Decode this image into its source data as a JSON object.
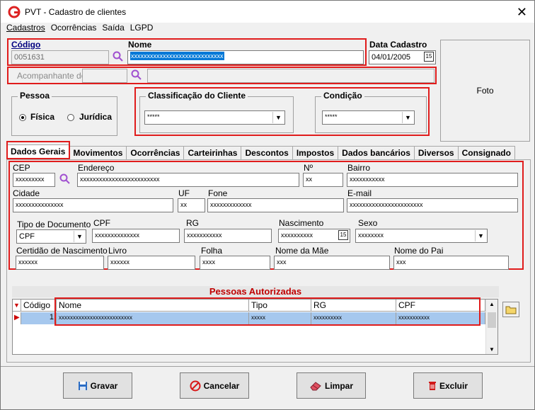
{
  "window": {
    "title": "PVT - Cadastro de clientes",
    "close_label": "✕"
  },
  "menu": [
    "Cadastros",
    "Ocorrências",
    "Saída",
    "LGPD"
  ],
  "header": {
    "codigo_label": "Código",
    "codigo_value": "0051631",
    "nome_label": "Nome",
    "nome_value": "xxxxxxxxxxxxxxxxxxxxxxxxxxxxx",
    "data_cadastro_label": "Data Cadastro",
    "data_cadastro_value": "04/01/2005",
    "acompanhante_label": "Acompanhante de",
    "foto_label": "Foto"
  },
  "pessoa": {
    "label": "Pessoa",
    "fisica": "Física",
    "juridica": "Jurídica",
    "selected": "Física"
  },
  "classificacao": {
    "label": "Classificação do Cliente",
    "value": "*****"
  },
  "condicao": {
    "label": "Condição",
    "value": "*****"
  },
  "tabs": [
    "Dados Gerais",
    "Movimentos",
    "Ocorrências",
    "Carteirinhas",
    "Descontos",
    "Impostos",
    "Dados bancários",
    "Diversos",
    "Consignado"
  ],
  "fields": {
    "cep_label": "CEP",
    "cep_value": "xxxxxxxxx",
    "endereco_label": "Endereço",
    "endereco_value": "xxxxxxxxxxxxxxxxxxxxxxxxx",
    "numero_label": "Nº",
    "numero_value": "xx",
    "bairro_label": "Bairro",
    "bairro_value": "xxxxxxxxxxx",
    "cidade_label": "Cidade",
    "cidade_value": "xxxxxxxxxxxxxxx",
    "uf_label": "UF",
    "uf_value": "xx",
    "fone_label": "Fone",
    "fone_value": "xxxxxxxxxxxxx",
    "email_label": "E-mail",
    "email_value": "xxxxxxxxxxxxxxxxxxxxxxx",
    "tipo_doc_label": "Tipo de Documento",
    "tipo_doc_value": "CPF",
    "cpf_label": "CPF",
    "cpf_value": "xxxxxxxxxxxxxx",
    "rg_label": "RG",
    "rg_value": "xxxxxxxxxxx",
    "nascimento_label": "Nascimento",
    "nascimento_value": "xxxxxxxxxx",
    "sexo_label": "Sexo",
    "sexo_value": "xxxxxxxx",
    "certidao_label": "Certidão de Nascimento",
    "certidao_value": "xxxxxx",
    "livro_label": "Livro",
    "livro_value": "xxxxxx",
    "folha_label": "Folha",
    "folha_value": "xxxx",
    "mae_label": "Nome da Mãe",
    "mae_value": "xxx",
    "pai_label": "Nome do Pai",
    "pai_value": "xxx"
  },
  "grid": {
    "title": "Pessoas Autorizadas",
    "columns": [
      "Código",
      "Nome",
      "Tipo",
      "RG",
      "CPF"
    ],
    "rows": [
      {
        "codigo": "1",
        "nome": "xxxxxxxxxxxxxxxxxxxxxxxxxx",
        "tipo": "xxxxx",
        "rg": "xxxxxxxxxx",
        "cpf": "xxxxxxxxxxx"
      }
    ]
  },
  "buttons": {
    "gravar": "Gravar",
    "cancelar": "Cancelar",
    "limpar": "Limpar",
    "excluir": "Excluir"
  },
  "colors": {
    "highlight_red": "#e01c1c",
    "selected_row": "#a6c8ee",
    "grid_title": "#c00000"
  }
}
